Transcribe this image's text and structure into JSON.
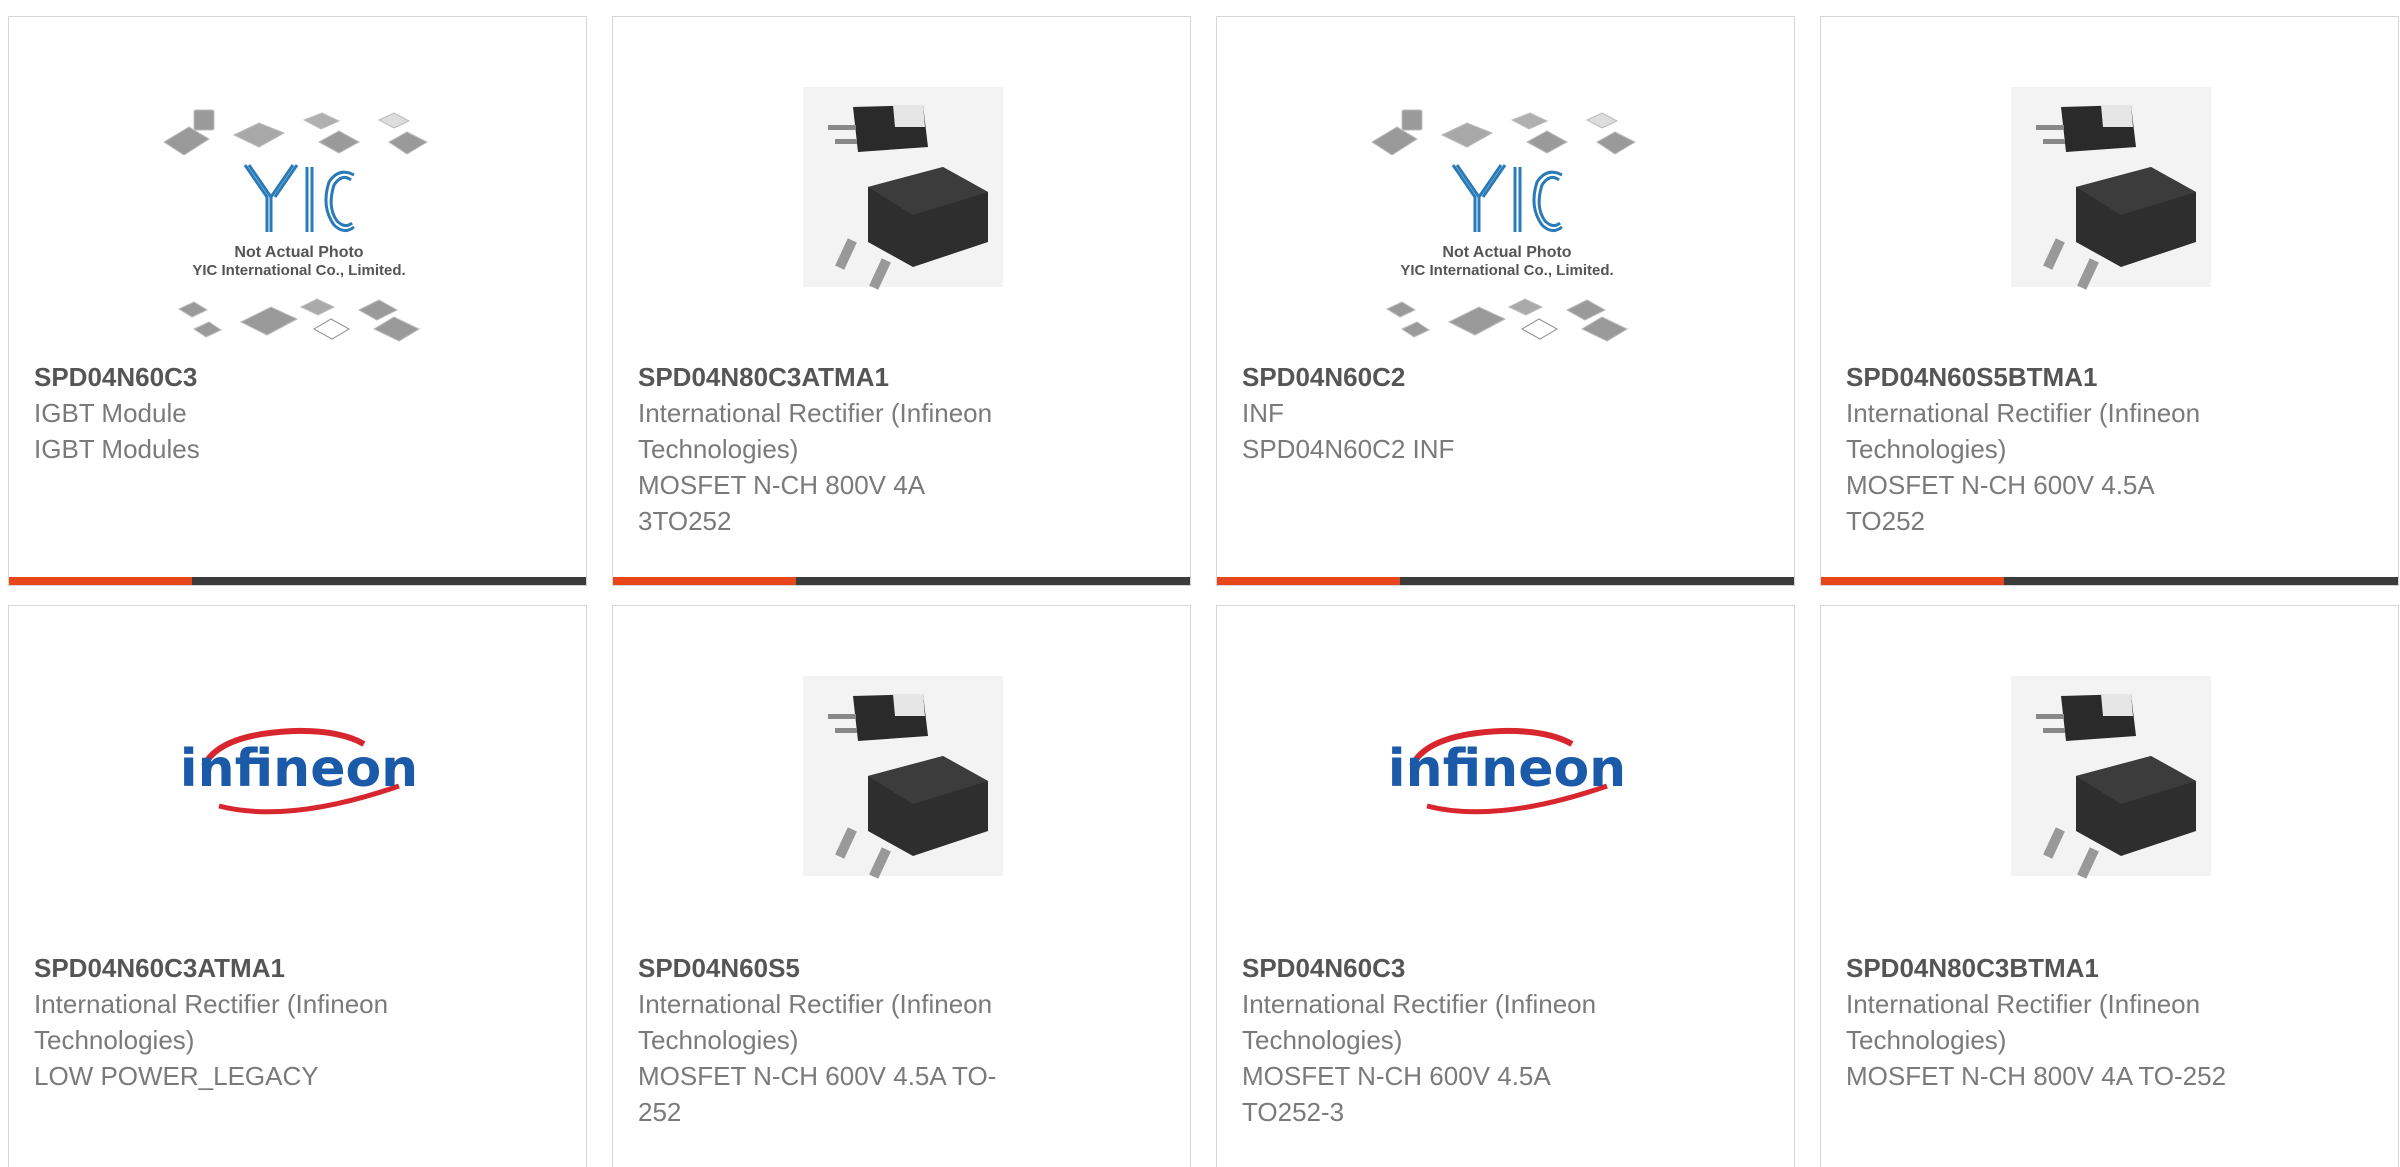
{
  "products": [
    {
      "part": "SPD04N60C3",
      "lines": [
        "IGBT Module",
        "IGBT Modules"
      ],
      "image": "yic-placeholder"
    },
    {
      "part": "SPD04N80C3ATMA1",
      "lines": [
        "International Rectifier (Infineon",
        "Technologies)",
        "MOSFET N-CH 800V 4A",
        "3TO252"
      ],
      "image": "to252-package"
    },
    {
      "part": "SPD04N60C2",
      "lines": [
        "INF",
        "SPD04N60C2 INF"
      ],
      "image": "yic-placeholder"
    },
    {
      "part": "SPD04N60S5BTMA1",
      "lines": [
        "International Rectifier (Infineon",
        "Technologies)",
        "MOSFET N-CH 600V 4.5A",
        "TO252"
      ],
      "image": "to252-package"
    },
    {
      "part": "SPD04N60C3ATMA1",
      "lines": [
        "International Rectifier (Infineon",
        "Technologies)",
        "LOW POWER_LEGACY"
      ],
      "image": "infineon-logo"
    },
    {
      "part": "SPD04N60S5",
      "lines": [
        "International Rectifier (Infineon",
        "Technologies)",
        "MOSFET N-CH 600V 4.5A TO-",
        "252"
      ],
      "image": "to252-package"
    },
    {
      "part": "SPD04N60C3",
      "lines": [
        "International Rectifier (Infineon",
        "Technologies)",
        "MOSFET N-CH 600V 4.5A",
        "TO252-3"
      ],
      "image": "infineon-logo"
    },
    {
      "part": "SPD04N80C3BTMA1",
      "lines": [
        "International Rectifier (Infineon",
        "Technologies)",
        "MOSFET N-CH 800V 4A TO-252"
      ],
      "image": "to252-package"
    }
  ],
  "placeholder": {
    "brand": "YIC",
    "note1": "Not Actual Photo",
    "note2": "YIC International Co., Limited."
  },
  "logo": {
    "text": "infineon"
  },
  "colors": {
    "accent": "#e8471c",
    "bar": "#3b3b3b",
    "infineon_blue": "#1a5aa8",
    "infineon_red": "#d7262d",
    "yic_blue": "#2a7ab8"
  }
}
